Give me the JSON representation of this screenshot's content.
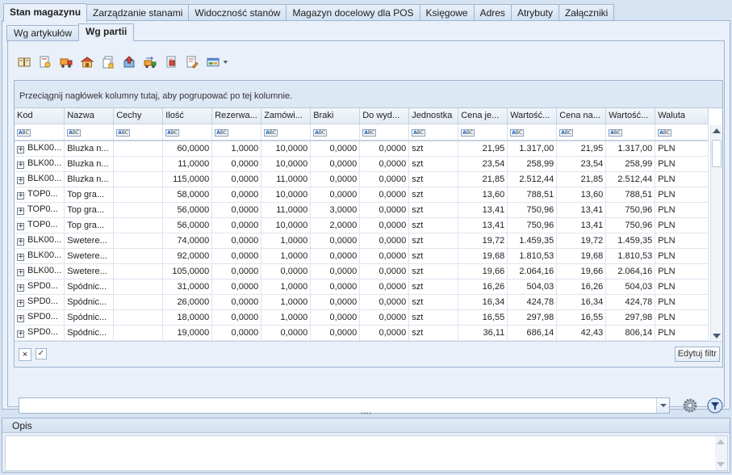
{
  "main_tabs": [
    {
      "label": "Stan magazynu",
      "active": true
    },
    {
      "label": "Zarządzanie stanami"
    },
    {
      "label": "Widoczność stanów"
    },
    {
      "label": "Magazyn docelowy dla POS"
    },
    {
      "label": "Księgowe"
    },
    {
      "label": "Adres"
    },
    {
      "label": "Atrybuty"
    },
    {
      "label": "Załączniki"
    }
  ],
  "sub_tabs": [
    {
      "label": "Wg artykułów"
    },
    {
      "label": "Wg partii",
      "active": true
    }
  ],
  "toolbar_icons": [
    "book-icon",
    "document-search-icon",
    "truck-icon",
    "warehouse-icon",
    "document-copy-icon",
    "export-icon",
    "truck-transfer-icon",
    "document-red-icon",
    "document-pencil-icon",
    "layout-dropdown-icon"
  ],
  "group_panel_text": "Przeciągnij nagłówek kolumny tutaj, aby pogrupować po tej kolumnie.",
  "filter_badge": {
    "a": "A",
    "bc": "BC"
  },
  "columns": [
    "Kod",
    "Nazwa",
    "Cechy",
    "Ilość",
    "Rezerwa...",
    "Zamówi...",
    "Braki",
    "Do wyd...",
    "Jednostka",
    "Cena je...",
    "Wartość...",
    "Cena na...",
    "Wartość...",
    "Waluta"
  ],
  "expand_symbol": "+",
  "rows": [
    [
      "BLK00...",
      "Bluzka n...",
      "",
      "60,0000",
      "1,0000",
      "10,0000",
      "0,0000",
      "0,0000",
      "szt",
      "21,95",
      "1.317,00",
      "21,95",
      "1.317,00",
      "PLN"
    ],
    [
      "BLK00...",
      "Bluzka n...",
      "",
      "11,0000",
      "0,0000",
      "10,0000",
      "0,0000",
      "0,0000",
      "szt",
      "23,54",
      "258,99",
      "23,54",
      "258,99",
      "PLN"
    ],
    [
      "BLK00...",
      "Bluzka n...",
      "",
      "115,0000",
      "0,0000",
      "11,0000",
      "0,0000",
      "0,0000",
      "szt",
      "21,85",
      "2.512,44",
      "21,85",
      "2.512,44",
      "PLN"
    ],
    [
      "TOP0...",
      "Top gra...",
      "",
      "58,0000",
      "0,0000",
      "10,0000",
      "0,0000",
      "0,0000",
      "szt",
      "13,60",
      "788,51",
      "13,60",
      "788,51",
      "PLN"
    ],
    [
      "TOP0...",
      "Top gra...",
      "",
      "56,0000",
      "0,0000",
      "11,0000",
      "3,0000",
      "0,0000",
      "szt",
      "13,41",
      "750,96",
      "13,41",
      "750,96",
      "PLN"
    ],
    [
      "TOP0...",
      "Top gra...",
      "",
      "56,0000",
      "0,0000",
      "10,0000",
      "2,0000",
      "0,0000",
      "szt",
      "13,41",
      "750,96",
      "13,41",
      "750,96",
      "PLN"
    ],
    [
      "BLK00...",
      "Swetere...",
      "",
      "74,0000",
      "0,0000",
      "1,0000",
      "0,0000",
      "0,0000",
      "szt",
      "19,72",
      "1.459,35",
      "19,72",
      "1.459,35",
      "PLN"
    ],
    [
      "BLK00...",
      "Swetere...",
      "",
      "92,0000",
      "0,0000",
      "1,0000",
      "0,0000",
      "0,0000",
      "szt",
      "19,68",
      "1.810,53",
      "19,68",
      "1.810,53",
      "PLN"
    ],
    [
      "BLK00...",
      "Swetere...",
      "",
      "105,0000",
      "0,0000",
      "0,0000",
      "0,0000",
      "0,0000",
      "szt",
      "19,66",
      "2.064,16",
      "19,66",
      "2.064,16",
      "PLN"
    ],
    [
      "SPD0...",
      "Spódnic...",
      "",
      "31,0000",
      "0,0000",
      "1,0000",
      "0,0000",
      "0,0000",
      "szt",
      "16,26",
      "504,03",
      "16,26",
      "504,03",
      "PLN"
    ],
    [
      "SPD0...",
      "Spódnic...",
      "",
      "26,0000",
      "0,0000",
      "1,0000",
      "0,0000",
      "0,0000",
      "szt",
      "16,34",
      "424,78",
      "16,34",
      "424,78",
      "PLN"
    ],
    [
      "SPD0...",
      "Spódnic...",
      "",
      "18,0000",
      "0,0000",
      "1,0000",
      "0,0000",
      "0,0000",
      "szt",
      "16,55",
      "297,98",
      "16,55",
      "297,98",
      "PLN"
    ],
    [
      "SPD0...",
      "Spódnic...",
      "",
      "19,0000",
      "0,0000",
      "0,0000",
      "0,0000",
      "0,0000",
      "szt",
      "36,11",
      "686,14",
      "42,43",
      "806,14",
      "PLN"
    ]
  ],
  "footer": {
    "close_symbol": "×",
    "check_symbol": "✓",
    "edit_filter_label": "Edytuj filtr"
  },
  "filter_combo": {
    "value": ""
  },
  "splitter_dots": "••••",
  "opis": {
    "title": "Opis",
    "value": ""
  }
}
